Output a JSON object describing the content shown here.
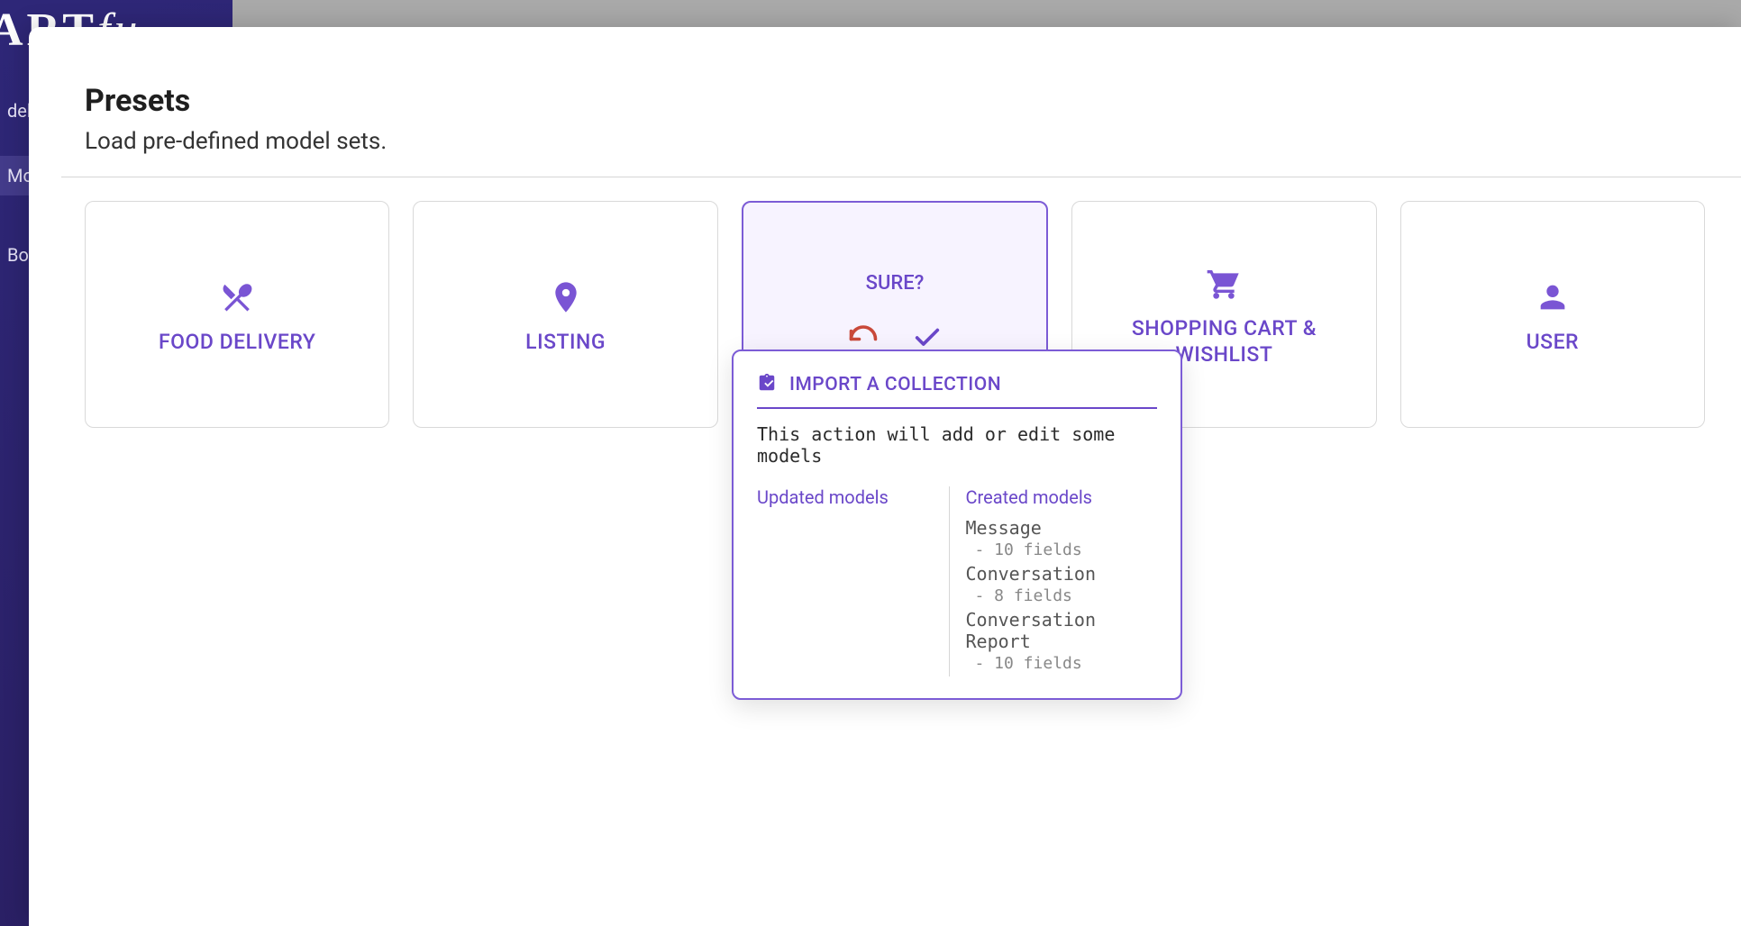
{
  "brand_part1": "ART",
  "brand_part2": "fu",
  "sidebar": {
    "items": [
      {
        "label": "deliv",
        "active": false
      },
      {
        "label": "Mo",
        "active": true
      },
      {
        "label": "Bo",
        "active": false
      }
    ]
  },
  "modal": {
    "title": "Presets",
    "subtitle": "Load pre-defined model sets."
  },
  "cards": [
    {
      "label": "FOOD DELIVERY"
    },
    {
      "label": "LISTING"
    },
    {
      "sure_label": "SURE?"
    },
    {
      "label": "SHOPPING CART & WISHLIST"
    },
    {
      "label": "USER"
    }
  ],
  "popover": {
    "header_title": "IMPORT A COLLECTION",
    "description": "This action will add or edit some models",
    "updated_title": "Updated models",
    "created_title": "Created models",
    "created_models": [
      {
        "name": "Message",
        "fields": "- 10 fields"
      },
      {
        "name": "Conversation",
        "fields": "- 8 fields"
      },
      {
        "name": "Conversation Report",
        "fields": "- 10 fields"
      }
    ]
  }
}
